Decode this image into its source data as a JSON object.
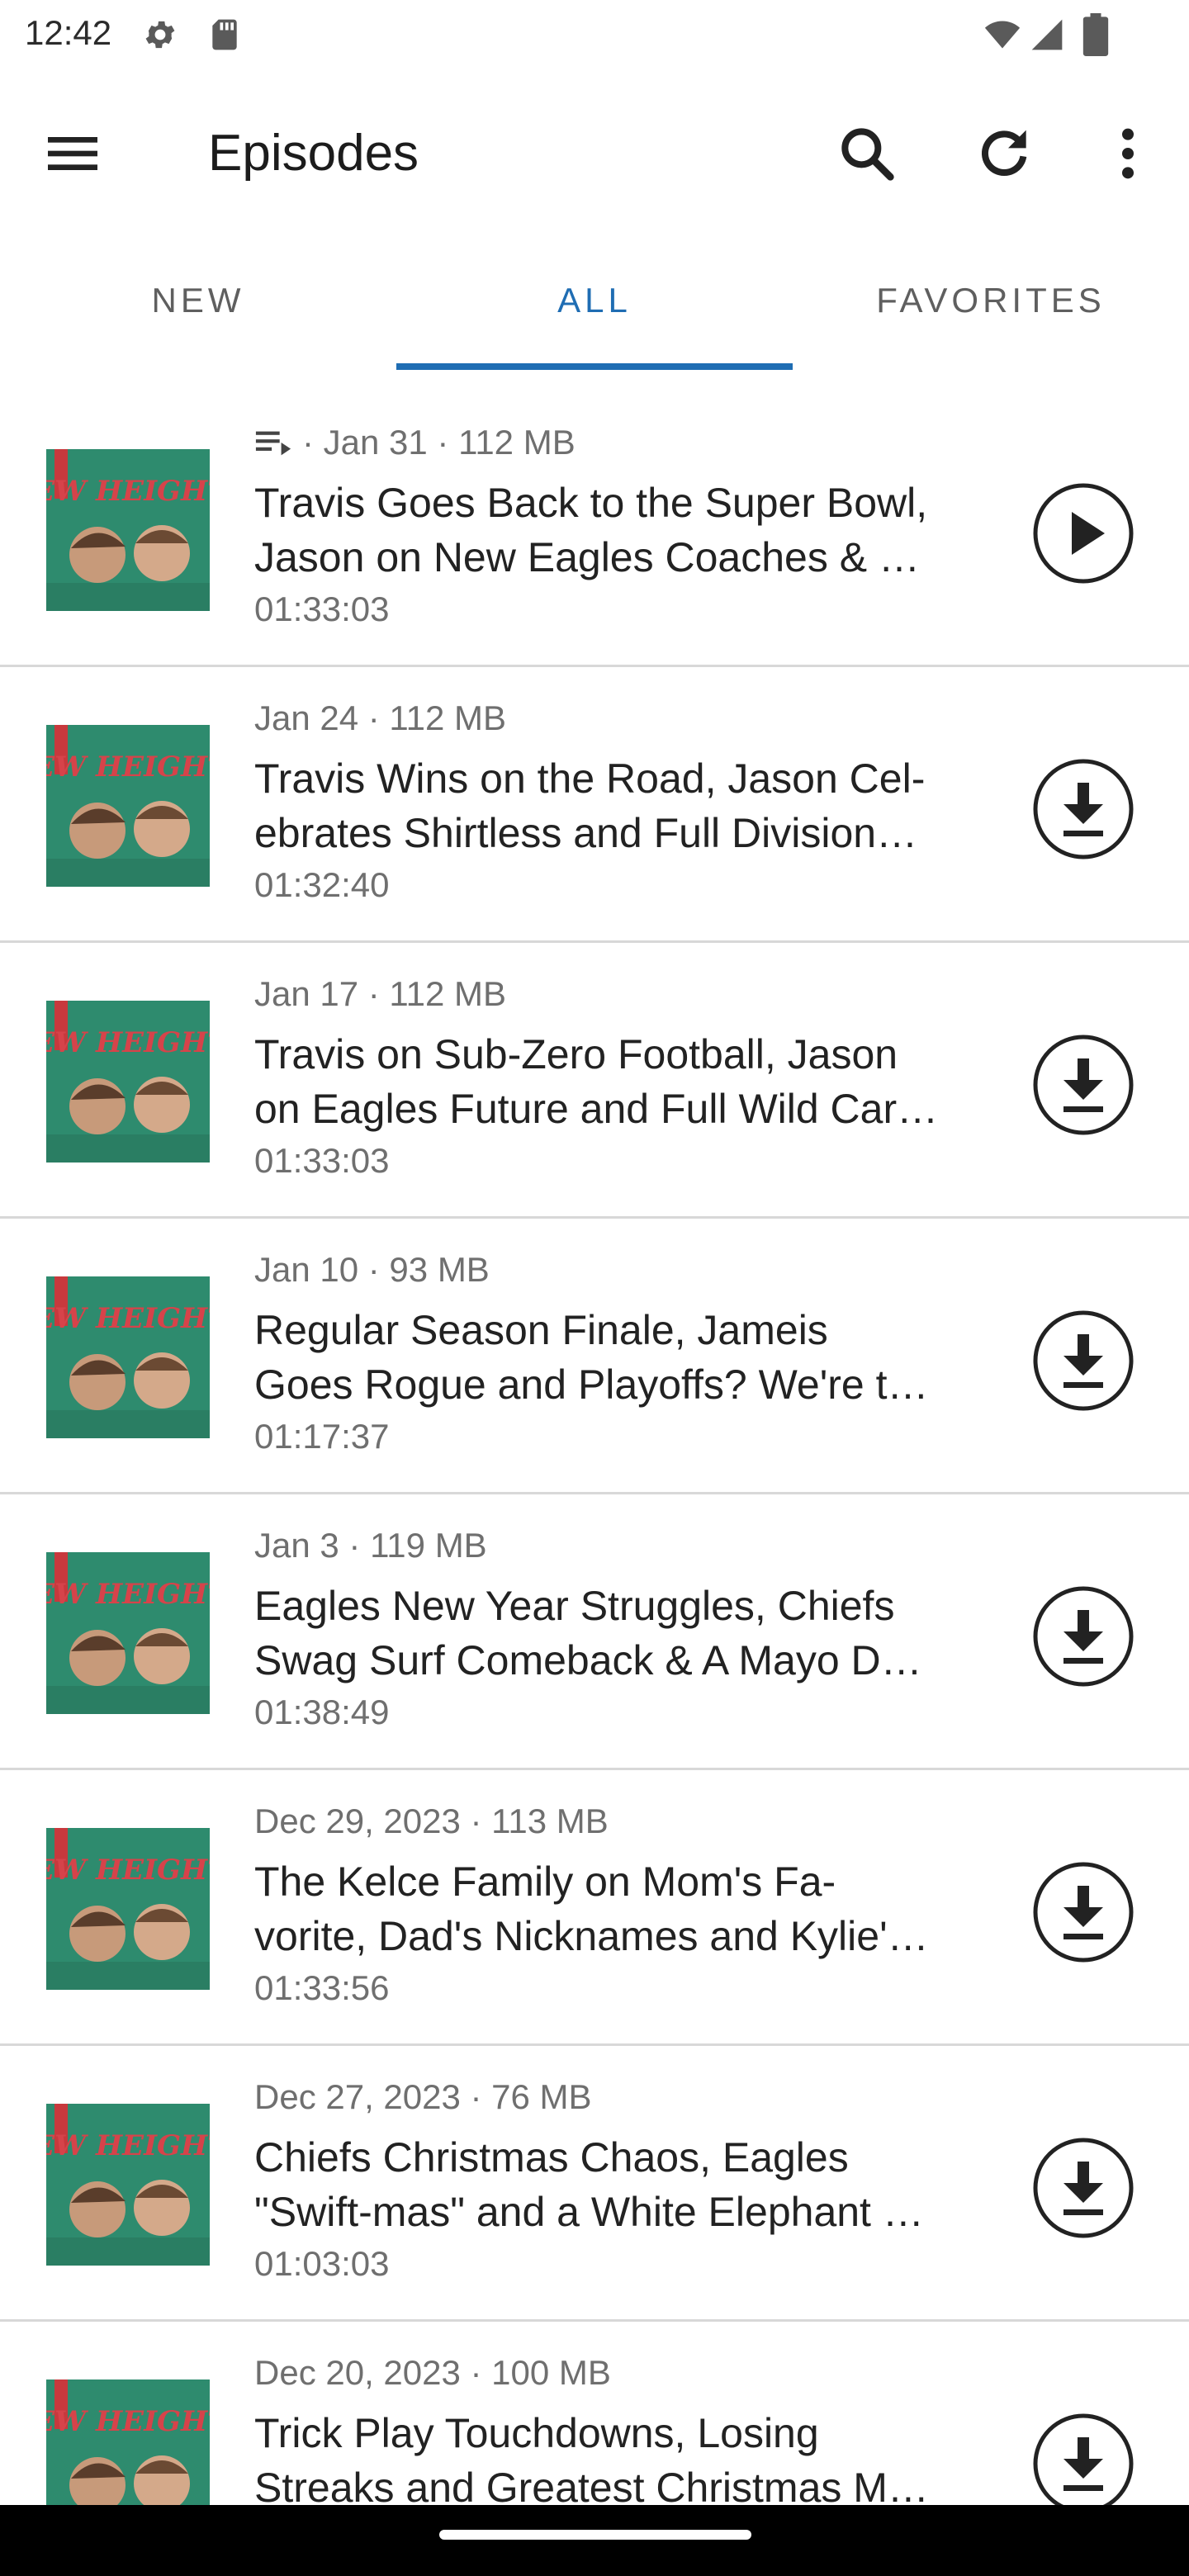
{
  "status_bar": {
    "time": "12:42"
  },
  "app_bar": {
    "title": "Episodes",
    "icons": [
      "menu-icon",
      "search-icon",
      "refresh-icon",
      "more-vert-icon"
    ]
  },
  "tabs": [
    {
      "label": "NEW",
      "active": false
    },
    {
      "label": "ALL",
      "active": true
    },
    {
      "label": "FAVORITES",
      "active": false
    }
  ],
  "colors": {
    "accent": "#1f6db3",
    "thumb_green": "#2e8b6e",
    "thumb_red": "#c7393d"
  },
  "episodes": [
    {
      "meta": "· Jan 31 · 112 MB",
      "queued": true,
      "title_line1": "Travis Goes Back to the Super Bowl,",
      "title_line2": "Jason on New Eagles Coaches & …",
      "duration": "01:33:03",
      "action": "play-icon",
      "thumb_text": "NEW HEIGHTS"
    },
    {
      "meta": "Jan 24 · 112 MB",
      "queued": false,
      "title_line1": "Travis Wins on the Road, Jason Cel-",
      "title_line2": "ebrates Shirtless and Full Division…",
      "duration": "01:32:40",
      "action": "download-icon",
      "thumb_text": "NEW HEIGHTS"
    },
    {
      "meta": "Jan 17 · 112 MB",
      "queued": false,
      "title_line1": "Travis on Sub-Zero Football, Jason",
      "title_line2": "on Eagles Future and Full Wild Car…",
      "duration": "01:33:03",
      "action": "download-icon",
      "thumb_text": "NEW HEIGHTS"
    },
    {
      "meta": "Jan 10 · 93 MB",
      "queued": false,
      "title_line1": "Regular Season Finale, Jameis",
      "title_line2": "Goes Rogue and Playoffs? We're t…",
      "duration": "01:17:37",
      "action": "download-icon",
      "thumb_text": "NEW HEIGHTS"
    },
    {
      "meta": "Jan 3 · 119 MB",
      "queued": false,
      "title_line1": "Eagles New Year Struggles, Chiefs",
      "title_line2": "Swag Surf Comeback & A Mayo D…",
      "duration": "01:38:49",
      "action": "download-icon",
      "thumb_text": "NEW HEIGHTS"
    },
    {
      "meta": "Dec 29, 2023 · 113 MB",
      "queued": false,
      "title_line1": "The Kelce Family on Mom's Fa-",
      "title_line2": "vorite, Dad's Nicknames and Kylie'…",
      "duration": "01:33:56",
      "action": "download-icon",
      "thumb_text": "NEW HEIGHTS"
    },
    {
      "meta": "Dec 27, 2023 · 76 MB",
      "queued": false,
      "title_line1": "Chiefs Christmas Chaos, Eagles",
      "title_line2": "\"Swift-mas\" and a White Elephant …",
      "duration": "01:03:03",
      "action": "download-icon",
      "thumb_text": "NEW HEIGHTS"
    },
    {
      "meta": "Dec 20, 2023 · 100 MB",
      "queued": false,
      "title_line1": "Trick Play Touchdowns, Losing",
      "title_line2": "Streaks and Greatest Christmas M…",
      "duration": "",
      "action": "download-icon",
      "thumb_text": "NEW HEIGHTS"
    }
  ]
}
